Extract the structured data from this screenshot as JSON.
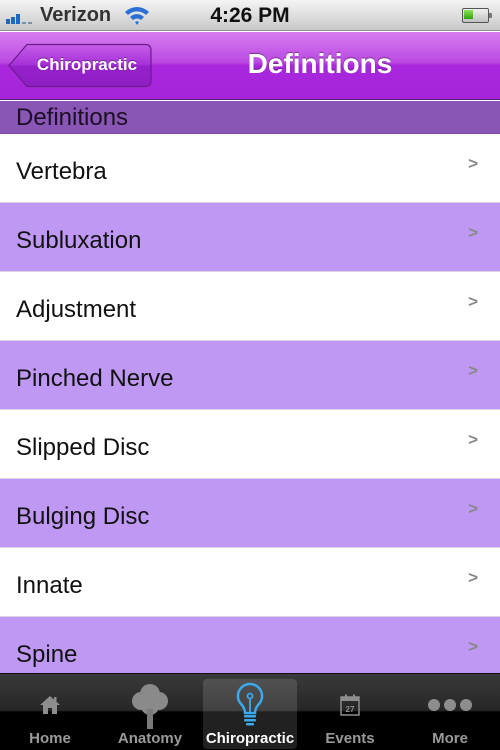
{
  "status_bar": {
    "carrier": "Verizon",
    "time": "4:26 PM",
    "signal_bars": 3,
    "signal_bars_max": 5,
    "battery_level": 0.4,
    "wifi": true
  },
  "nav_bar": {
    "back_label": "Chiropractic",
    "title": "Definitions"
  },
  "section": {
    "header": "Definitions"
  },
  "list": {
    "chevron": ">",
    "items": [
      {
        "label": "Vertebra"
      },
      {
        "label": "Subluxation"
      },
      {
        "label": "Adjustment"
      },
      {
        "label": "Pinched Nerve"
      },
      {
        "label": "Slipped Disc"
      },
      {
        "label": "Bulging Disc"
      },
      {
        "label": "Innate"
      },
      {
        "label": "Spine"
      }
    ]
  },
  "tab_bar": {
    "selected": "Chiropractic",
    "tabs": [
      {
        "label": "Home",
        "icon": "home-icon"
      },
      {
        "label": "Anatomy",
        "icon": "tree-icon"
      },
      {
        "label": "Chiropractic",
        "icon": "lightbulb-icon"
      },
      {
        "label": "Events",
        "icon": "calendar-icon",
        "badge_text": "27"
      },
      {
        "label": "More",
        "icon": "more-icon"
      }
    ]
  },
  "colors": {
    "nav_purple": "#a927dc",
    "section_header": "#8a56b6",
    "row_alt": "#be98f2",
    "selected_icon": "#39a9f0"
  }
}
